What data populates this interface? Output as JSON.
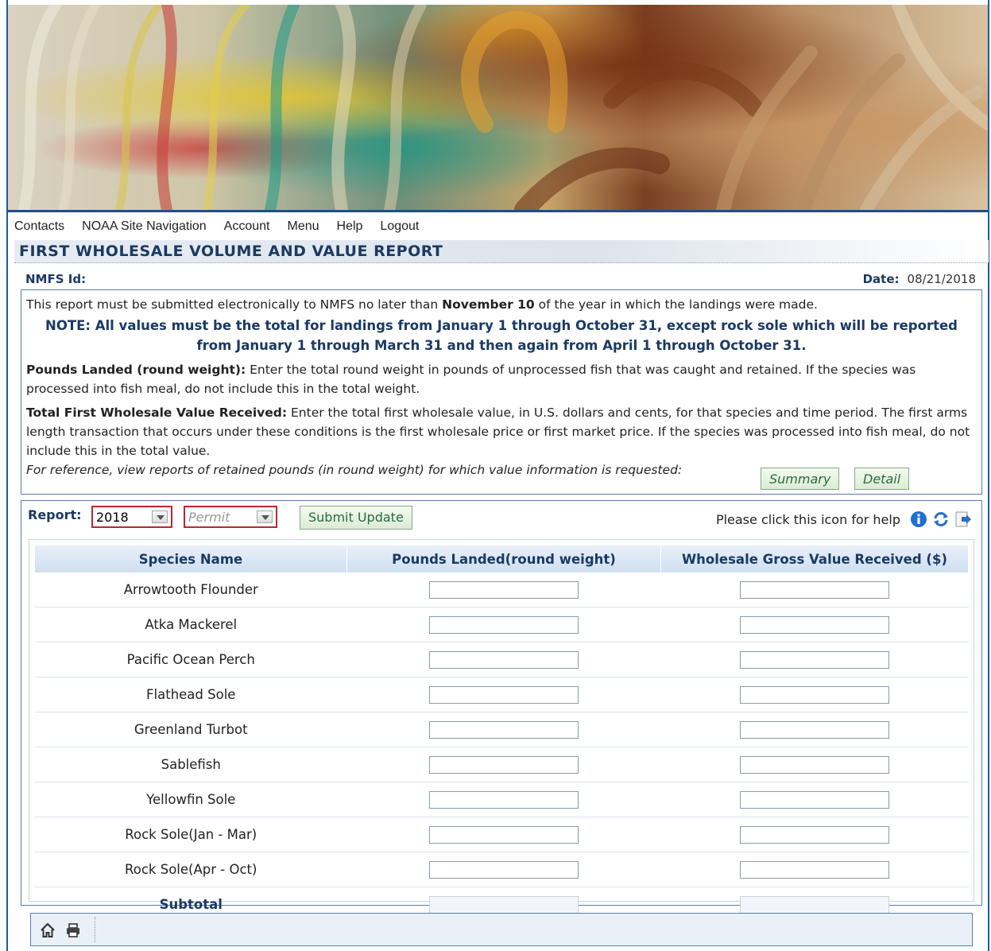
{
  "nav": {
    "items": [
      "Contacts",
      "NOAA Site Navigation",
      "Account",
      "Menu",
      "Help",
      "Logout"
    ]
  },
  "page": {
    "title": "FIRST WHOLESALE VOLUME AND VALUE REPORT",
    "nmfs_label": "NMFS Id:",
    "date_label": "Date:",
    "date_value": "08/21/2018"
  },
  "info": {
    "intro_pre": "This report must be submitted electronically to NMFS no later than ",
    "intro_bold": "November 10",
    "intro_post": " of the year in which the landings were made.",
    "note": "NOTE: All values must be the total for landings from January 1 through October 31, except rock sole which will be reported from January 1 through March 31 and then again from April 1 through October 31.",
    "pounds_heading": "Pounds Landed (round weight):",
    "pounds_text": " Enter the total round weight in pounds of unprocessed fish that was caught and retained. If the species was processed into fish meal, do not include this in the total weight.",
    "value_heading": "Total First Wholesale Value Received:",
    "value_text": " Enter the total first wholesale value, in U.S. dollars and cents, for that species and time period. The first arms length transaction that occurs under these conditions is the first wholesale price or first market price. If the species was processed into fish meal, do not include this in the total value.",
    "reference_text": "For reference, view reports of retained pounds (in round weight) for which value information is requested:",
    "summary_button": "Summary",
    "detail_button": "Detail"
  },
  "form": {
    "report_label": "Report:",
    "year_value": "2018",
    "permit_placeholder": "Permit",
    "submit_button": "Submit Update",
    "help_text": "Please click this icon for help"
  },
  "table": {
    "headers": [
      "Species Name",
      "Pounds Landed(round weight)",
      "Wholesale Gross Value Received ($)"
    ],
    "rows": [
      {
        "name": "Arrowtooth Flounder"
      },
      {
        "name": "Atka Mackerel"
      },
      {
        "name": "Pacific Ocean Perch"
      },
      {
        "name": "Flathead Sole"
      },
      {
        "name": "Greenland Turbot"
      },
      {
        "name": "Sablefish"
      },
      {
        "name": "Yellowfin Sole"
      },
      {
        "name": "Rock Sole(Jan - Mar)"
      },
      {
        "name": "Rock Sole(Apr - Oct)"
      }
    ],
    "subtotal_label": "Subtotal"
  },
  "colors": {
    "accent_blue": "#1b3a63",
    "border_blue": "#5a7fa8",
    "required_red": "#c2252e",
    "button_green": "#2a6a44"
  },
  "icons": {
    "help": "info-icon",
    "refresh": "refresh-icon",
    "export": "export-icon",
    "home": "home-icon",
    "print": "print-icon"
  }
}
